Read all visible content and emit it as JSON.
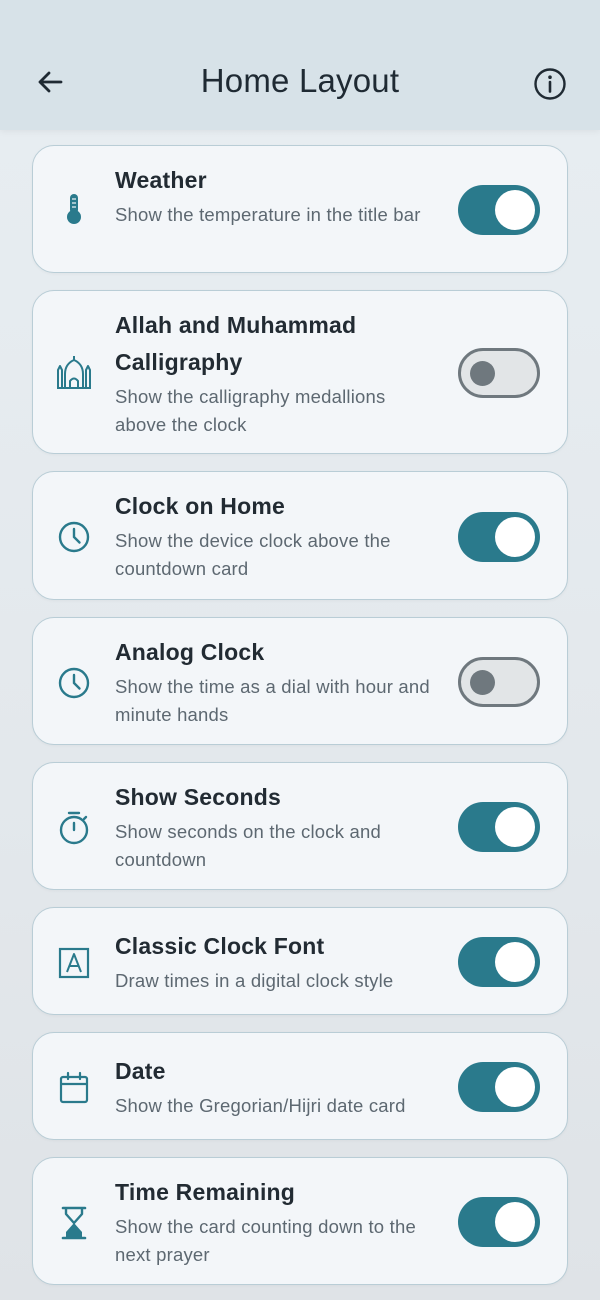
{
  "header": {
    "title": "Home Layout",
    "back_icon": "arrow-back-icon",
    "info_icon": "info-icon"
  },
  "colors": {
    "accent": "#2a7a8c",
    "card_bg": "#f3f6f9",
    "card_border": "#b9cdd6",
    "appbar_bg": "#d7e2e8"
  },
  "settings": [
    {
      "icon": "thermometer-icon",
      "title": "Weather",
      "description": "Show the temperature in the title bar",
      "enabled": true
    },
    {
      "icon": "mosque-icon",
      "title": "Allah and Muhammad Calligraphy",
      "description": "Show the calligraphy medallions above the clock",
      "enabled": false
    },
    {
      "icon": "clock-icon",
      "title": "Clock on Home",
      "description": "Show the device clock above the countdown card",
      "enabled": true
    },
    {
      "icon": "clock-icon",
      "title": "Analog Clock",
      "description": "Show the time as a dial with hour and minute hands",
      "enabled": false
    },
    {
      "icon": "stopwatch-icon",
      "title": "Show Seconds",
      "description": "Show seconds on the clock and countdown",
      "enabled": true
    },
    {
      "icon": "font-icon",
      "title": "Classic Clock Font",
      "description": "Draw times in a digital clock style",
      "enabled": true
    },
    {
      "icon": "calendar-icon",
      "title": "Date",
      "description": "Show the Gregorian/Hijri date card",
      "enabled": true
    },
    {
      "icon": "hourglass-icon",
      "title": "Time Remaining",
      "description": "Show the card counting down to the next prayer",
      "enabled": true
    }
  ]
}
